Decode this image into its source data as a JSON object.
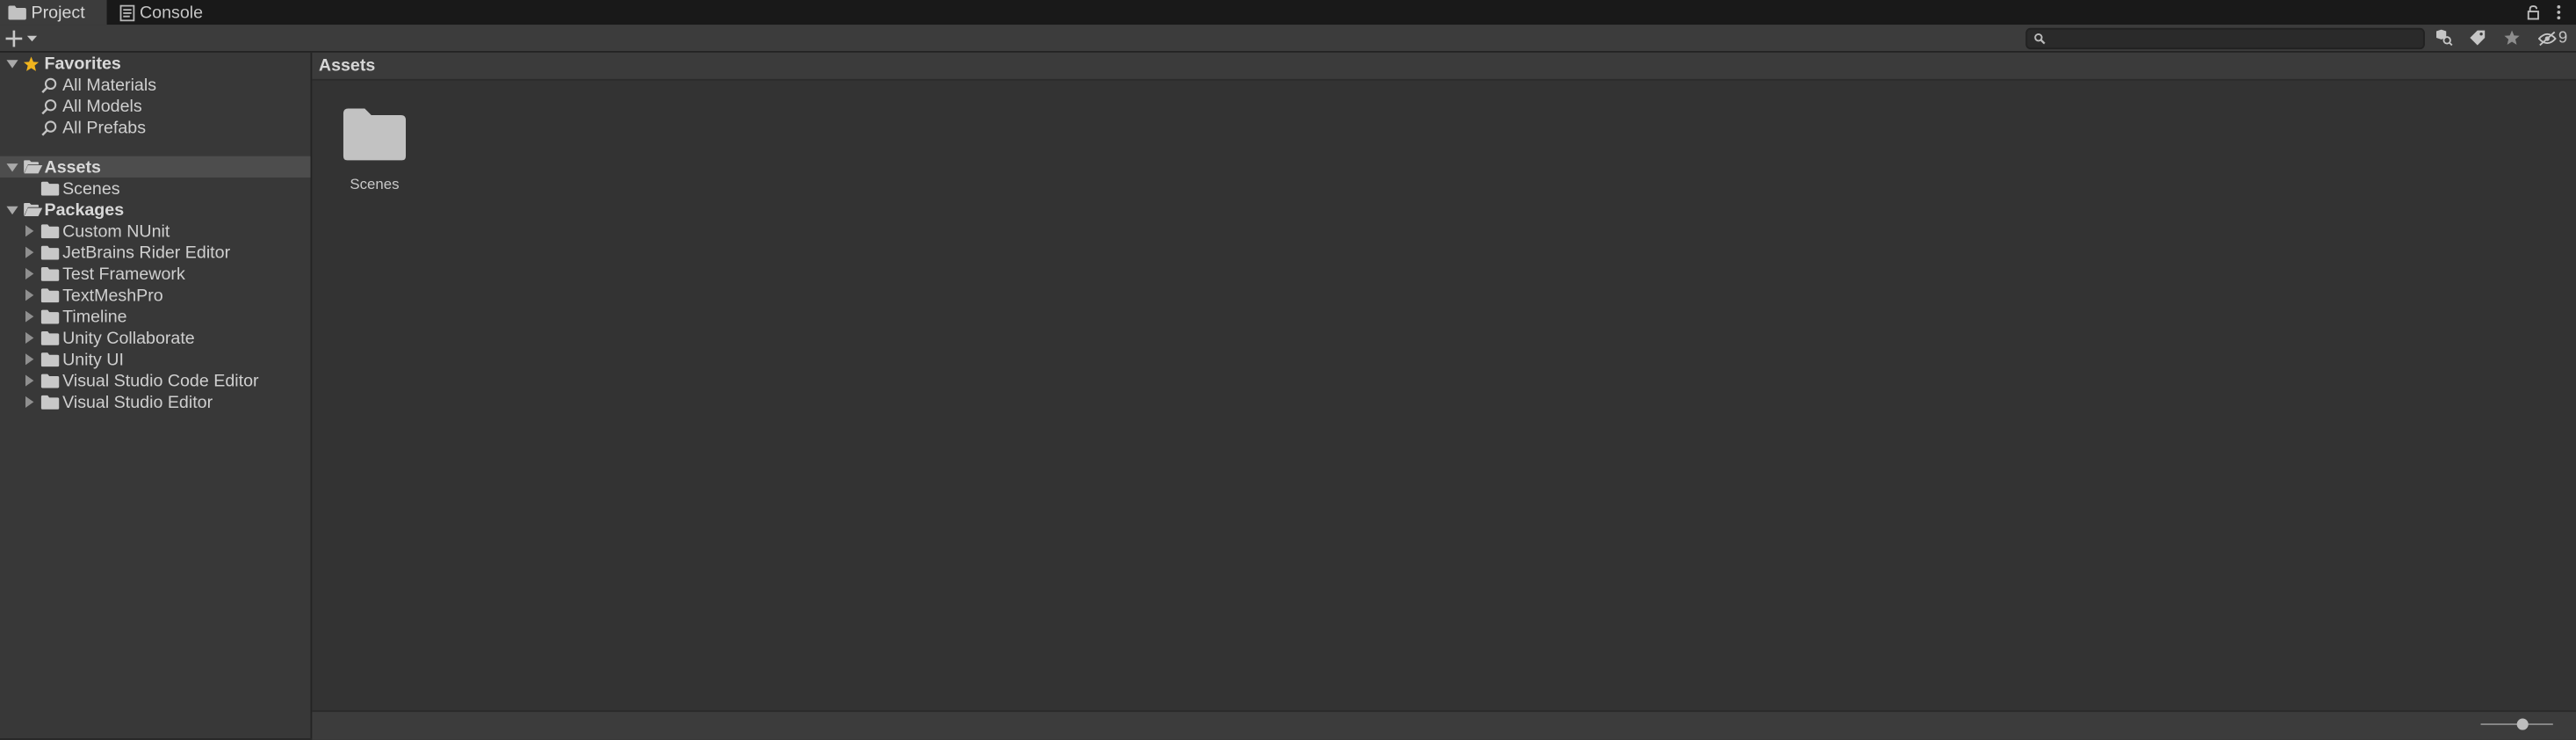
{
  "tabs": [
    {
      "label": "Project",
      "icon": "folder-icon",
      "active": true
    },
    {
      "label": "Console",
      "icon": "console-icon",
      "active": false
    }
  ],
  "toolbar": {
    "search_value": "",
    "hidden_packages_count": "9"
  },
  "favorites": {
    "label": "Favorites",
    "items": [
      "All Materials",
      "All Models",
      "All Prefabs"
    ]
  },
  "assets": {
    "label": "Assets",
    "children": [
      "Scenes"
    ]
  },
  "packages": {
    "label": "Packages",
    "children": [
      "Custom NUnit",
      "JetBrains Rider Editor",
      "Test Framework",
      "TextMeshPro",
      "Timeline",
      "Unity Collaborate",
      "Unity UI",
      "Visual Studio Code Editor",
      "Visual Studio Editor"
    ]
  },
  "content": {
    "breadcrumb": "Assets",
    "items": [
      {
        "label": "Scenes",
        "icon": "folder-icon"
      }
    ]
  },
  "colors": {
    "panel": "#383838",
    "content": "#333333",
    "tabbar": "#191919",
    "selection": "#4d4d4d",
    "favorite_star": "#f0b41e"
  }
}
